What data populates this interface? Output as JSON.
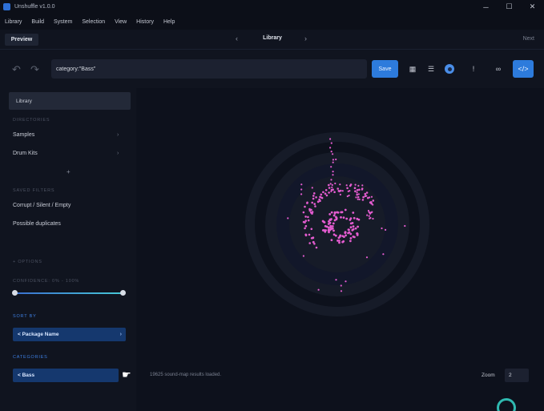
{
  "window": {
    "title": "Unshuffle v1.0.0",
    "minimize": "─",
    "maximize": "☐",
    "close": "✕"
  },
  "menu": [
    "Library",
    "Build",
    "System",
    "Selection",
    "View",
    "History",
    "Help"
  ],
  "tabs": {
    "preview": "Preview",
    "current": "Library",
    "next": "Next",
    "prev_arrow": "‹",
    "next_arrow": "›"
  },
  "toolbar": {
    "search_value": "category:\"Bass\"",
    "save_label": "Save",
    "undo_icon": "↶",
    "redo_icon": "↷",
    "grid_icon": "▦",
    "list_icon": "☰",
    "info_icon": "ǃ",
    "link_icon": "∞",
    "code_icon": "</>"
  },
  "sidebar": {
    "library_label": "Library",
    "directories_header": "DIRECTORIES",
    "samples": "Samples",
    "drum_kits": "Drum Kits",
    "add_icon": "+",
    "saved_filters_header": "SAVED FILTERS",
    "filter_1": "Corrupt / Silent / Empty",
    "filter_2": "Possible duplicates",
    "options_header": "+ OPTIONS",
    "confidence_label": "CONFIDENCE: 0% - 100%",
    "confidence_range": [
      0,
      100
    ],
    "sort_header": "SORT BY",
    "sort_value": "< Package Name",
    "categories_header": "CATEGORIES",
    "category_value": "< Bass",
    "chevron": "›"
  },
  "main": {
    "status": "19625 sound-map results loaded.",
    "zoom_label": "Zoom",
    "zoom_value": "2"
  },
  "colors": {
    "accent": "#2d7bdc",
    "points": "#e45cd0",
    "background": "#0d111c"
  }
}
